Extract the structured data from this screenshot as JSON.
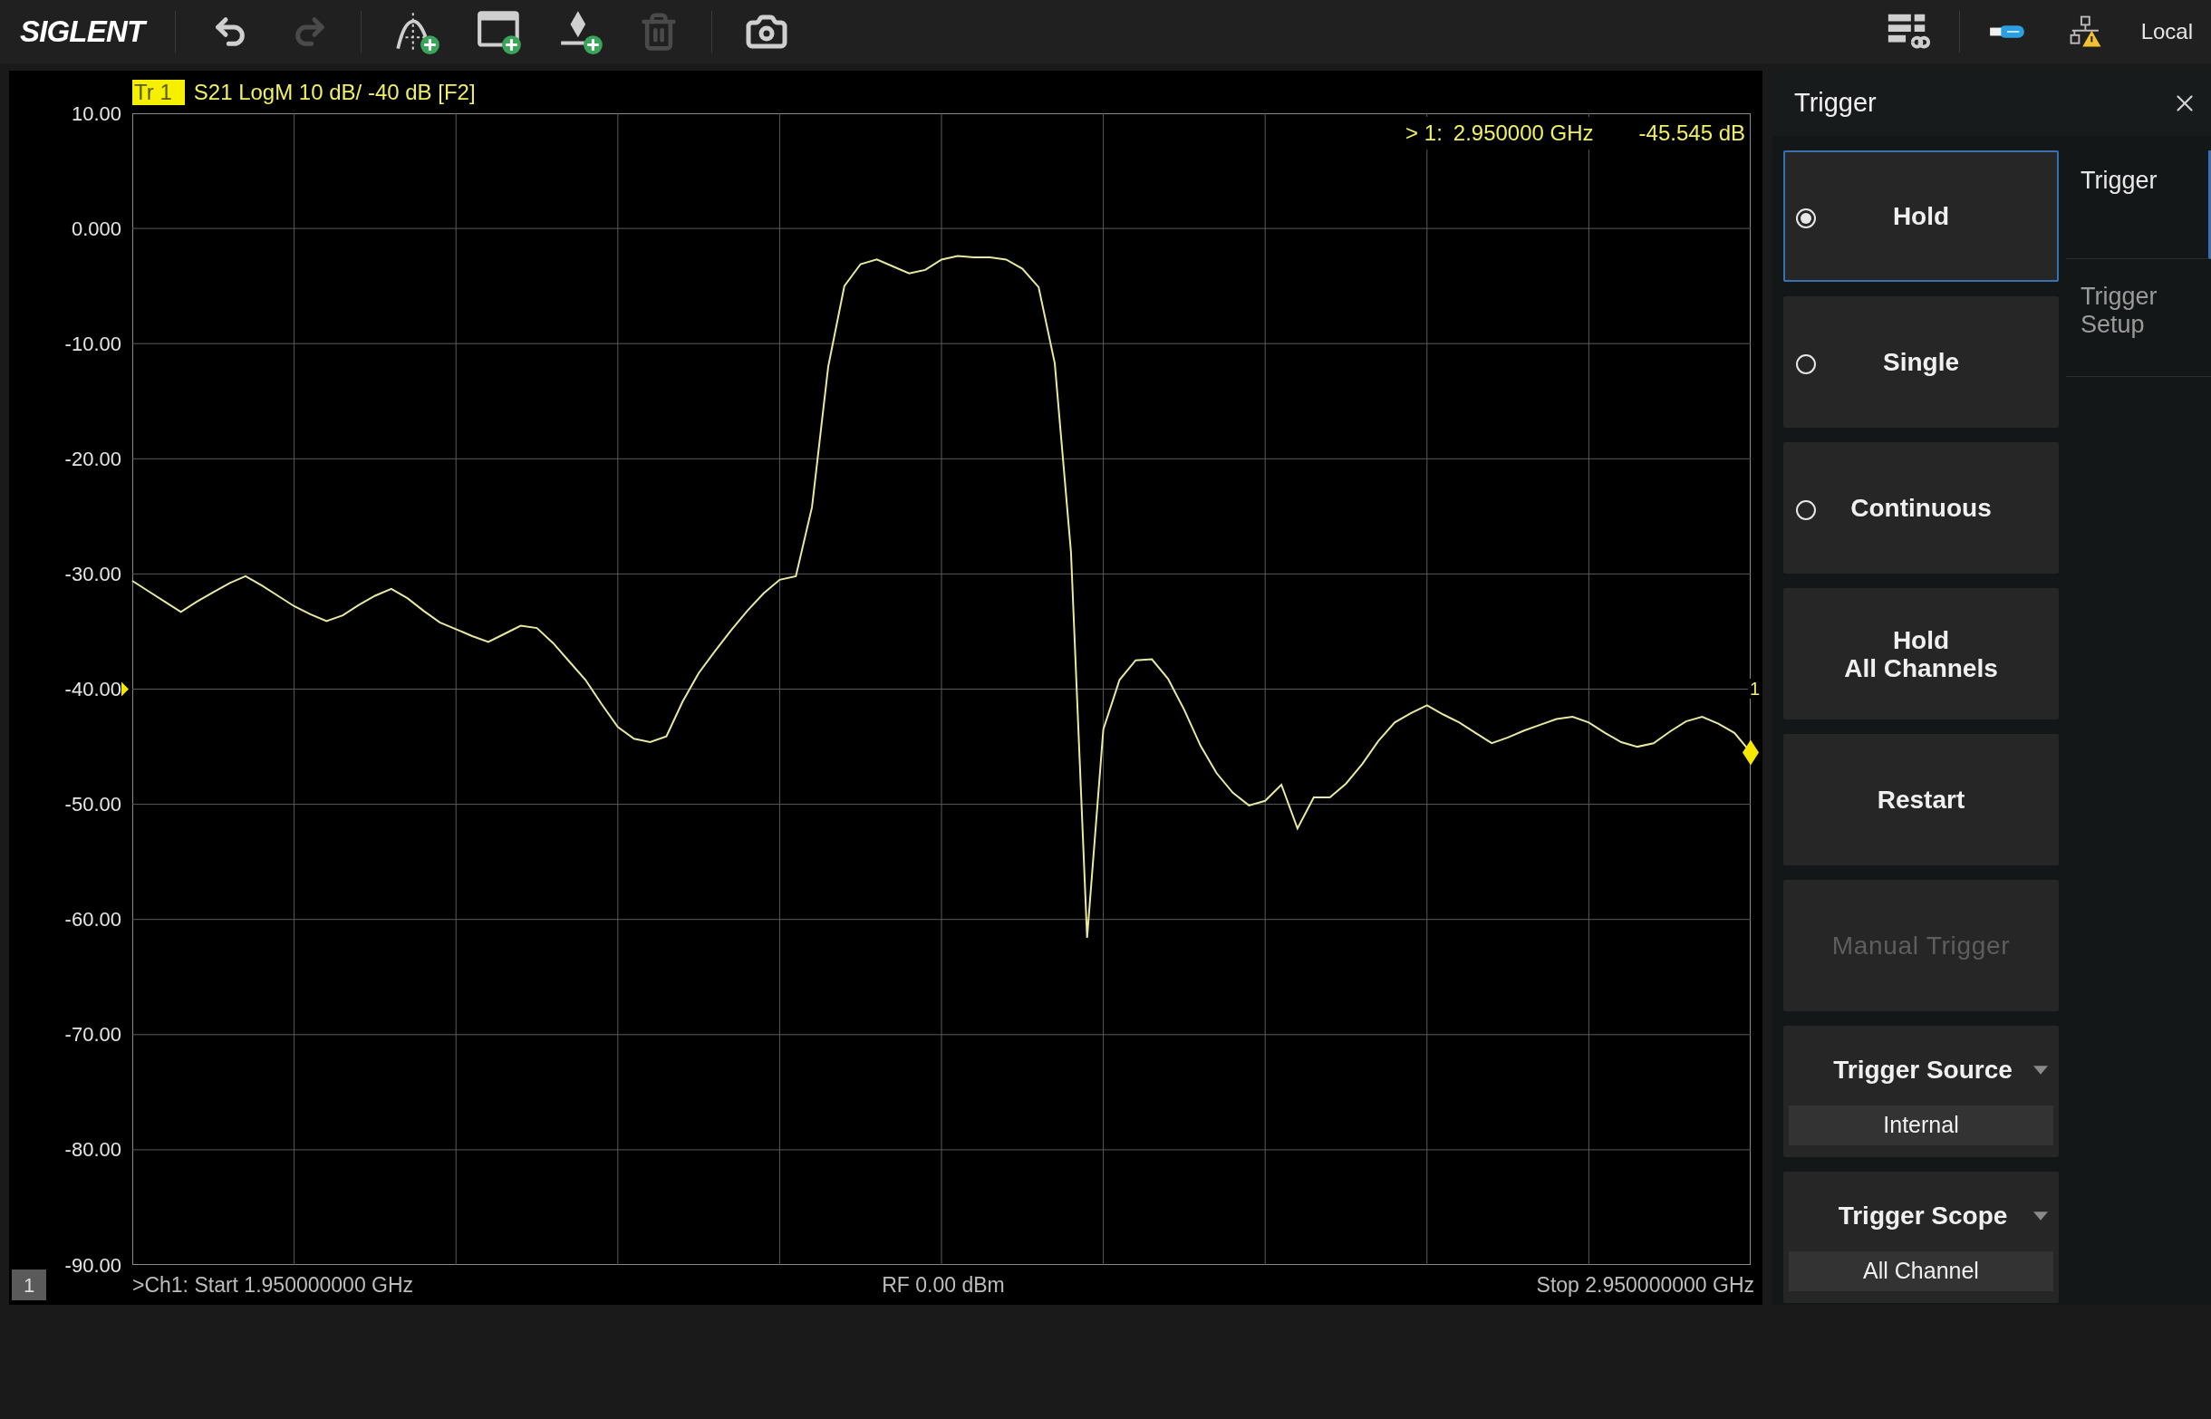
{
  "toolbar": {
    "logo": "SIGLENT",
    "tools": [
      {
        "kind": "undo",
        "disabled": false
      },
      {
        "kind": "redo",
        "disabled": true
      },
      {
        "kind": "add-trace",
        "disabled": false
      },
      {
        "kind": "add-window",
        "disabled": false
      },
      {
        "kind": "add-marker",
        "disabled": false
      },
      {
        "kind": "delete",
        "disabled": true
      },
      {
        "kind": "camera",
        "disabled": false
      }
    ],
    "status": "Local"
  },
  "trace_header": {
    "tag": "Tr 1",
    "description": "S21 LogM 10 dB/ -40 dB [F2]"
  },
  "marker_readout": {
    "label": "> 1:",
    "frequency": "2.950000 GHz",
    "value": "-45.545 dB"
  },
  "marker_label": "1",
  "plot": {
    "chart_data": {
      "type": "line",
      "grid": true,
      "ylim": [
        -90,
        10
      ],
      "yticks": [
        {
          "value": 10,
          "label": "10.00"
        },
        {
          "value": 0,
          "label": "0.000"
        },
        {
          "value": -10,
          "label": "-10.00"
        },
        {
          "value": -20,
          "label": "-20.00"
        },
        {
          "value": -30,
          "label": "-30.00"
        },
        {
          "value": -40,
          "label": "-40.00"
        },
        {
          "value": -50,
          "label": "-50.00"
        },
        {
          "value": -60,
          "label": "-60.00"
        },
        {
          "value": -70,
          "label": "-70.00"
        },
        {
          "value": -80,
          "label": "-80.00"
        },
        {
          "value": -90,
          "label": "-90.00"
        }
      ],
      "categories": [
        null,
        null,
        null,
        null,
        null,
        null,
        null,
        null,
        null,
        null,
        null,
        null,
        null,
        null,
        null,
        null,
        null,
        null,
        null,
        null,
        null,
        null,
        null,
        null,
        null,
        null,
        null,
        null,
        null,
        null,
        null,
        null,
        null,
        null,
        null,
        null,
        null,
        null,
        null,
        null,
        null,
        null,
        null,
        null,
        null,
        null,
        null,
        null,
        null,
        null,
        null,
        null,
        null,
        null,
        null,
        null,
        null,
        null,
        null,
        null,
        null,
        null,
        null,
        null,
        null,
        null,
        null,
        null,
        null,
        null,
        null,
        null,
        null,
        null,
        null,
        null,
        null,
        null,
        null,
        null,
        null,
        null,
        null,
        null,
        null,
        null,
        null,
        null,
        null,
        null,
        null,
        null,
        null,
        null,
        null,
        null,
        null,
        null,
        null,
        null,
        null
      ],
      "series": [
        {
          "color": "#e8e8a0",
          "values": [
            -30.6,
            -31.5,
            -32.4,
            -33.3,
            -32.4,
            -31.6,
            -30.8,
            -30.2,
            -31.0,
            -31.9,
            -32.8,
            -33.5,
            -34.1,
            -33.6,
            -32.7,
            -31.9,
            -31.3,
            -32.1,
            -33.2,
            -34.2,
            -34.8,
            -35.4,
            -35.9,
            -35.2,
            -34.5,
            -34.7,
            -36.0,
            -37.6,
            -39.2,
            -41.3,
            -43.3,
            -44.3,
            -44.6,
            -44.1,
            -41.1,
            -38.6,
            -36.7,
            -34.9,
            -33.2,
            -31.7,
            -30.5,
            -30.2,
            -24.2,
            -12.0,
            -5.0,
            -3.1,
            -2.7,
            -3.3,
            -3.9,
            -3.6,
            -2.7,
            -2.4,
            -2.5,
            -2.5,
            -2.7,
            -3.5,
            -5.1,
            -11.7,
            -28.1,
            -61.6,
            -43.5,
            -39.2,
            -37.5,
            -37.4,
            -39.1,
            -41.8,
            -44.9,
            -47.3,
            -49.0,
            -50.1,
            -49.7,
            -48.3,
            -52.1,
            -49.4,
            -49.4,
            -48.2,
            -46.5,
            -44.5,
            -42.9,
            -42.1,
            -41.4,
            -42.2,
            -42.9,
            -43.8,
            -44.7,
            -44.2,
            -43.6,
            -43.1,
            -42.6,
            -42.4,
            -42.9,
            -43.8,
            -44.6,
            -45.0,
            -44.7,
            -43.7,
            -42.8,
            -42.4,
            -43.0,
            -43.8,
            -45.5
          ]
        }
      ]
    }
  },
  "footer": {
    "channel": "1",
    "start": ">Ch1: Start 1.950000000 GHz",
    "power": "RF 0.00 dBm",
    "stop": "Stop 2.950000000 GHz"
  },
  "panel": {
    "title": "Trigger",
    "buttons": [
      {
        "kind": "radio",
        "label": "Hold",
        "selected": true,
        "disabled": false
      },
      {
        "kind": "radio",
        "label": "Single",
        "selected": false,
        "disabled": false
      },
      {
        "kind": "radio",
        "label": "Continuous",
        "selected": false,
        "disabled": false
      },
      {
        "kind": "action",
        "label": "Hold\nAll Channels",
        "disabled": false
      },
      {
        "kind": "action",
        "label": "Restart",
        "disabled": false
      },
      {
        "kind": "action",
        "label": "Manual Trigger",
        "disabled": true
      },
      {
        "kind": "dropdown",
        "label": "Trigger Source",
        "value": "Internal",
        "disabled": false
      },
      {
        "kind": "dropdown",
        "label": "Trigger Scope",
        "value": "All Channel",
        "disabled": false
      }
    ],
    "tabs": [
      {
        "label": "Trigger",
        "selected": true
      },
      {
        "label": "Trigger Setup",
        "selected": false
      }
    ]
  }
}
